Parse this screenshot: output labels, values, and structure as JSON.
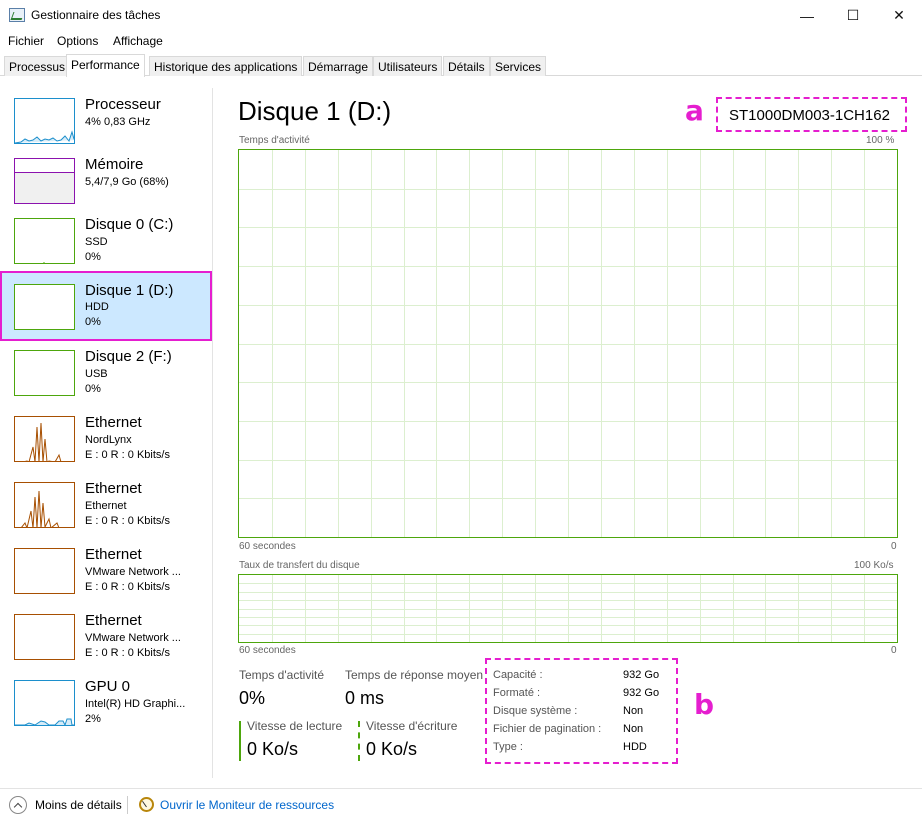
{
  "window": {
    "title": "Gestionnaire des tâches",
    "minimize_glyph": "—",
    "maximize_glyph": "☐",
    "close_glyph": "✕"
  },
  "menu": [
    "Fichier",
    "Options",
    "Affichage"
  ],
  "tabs": [
    "Processus",
    "Performance",
    "Historique des applications",
    "Démarrage",
    "Utilisateurs",
    "Détails",
    "Services"
  ],
  "active_tab": "Performance",
  "sidebar": {
    "items": [
      {
        "title": "Processeur",
        "sub1": "4% 0,83 GHz",
        "sub2": "",
        "color": "#1c8fcc"
      },
      {
        "title": "Mémoire",
        "sub1": "5,4/7,9 Go (68%)",
        "sub2": "",
        "color": "#8b12ae"
      },
      {
        "title": "Disque 0 (C:)",
        "sub1": "SSD",
        "sub2": "0%",
        "color": "#4da60c"
      },
      {
        "title": "Disque 1 (D:)",
        "sub1": "HDD",
        "sub2": "0%",
        "color": "#4da60c"
      },
      {
        "title": "Disque 2 (F:)",
        "sub1": "USB",
        "sub2": "0%",
        "color": "#4da60c"
      },
      {
        "title": "Ethernet",
        "sub1": "NordLynx",
        "sub2": "E : 0 R : 0 Kbits/s",
        "color": "#a74f01"
      },
      {
        "title": "Ethernet",
        "sub1": "Ethernet",
        "sub2": "E : 0 R : 0 Kbits/s",
        "color": "#a74f01"
      },
      {
        "title": "Ethernet",
        "sub1": "VMware Network ...",
        "sub2": "E : 0 R : 0 Kbits/s",
        "color": "#a74f01"
      },
      {
        "title": "Ethernet",
        "sub1": "VMware Network ...",
        "sub2": "E : 0 R : 0 Kbits/s",
        "color": "#a74f01"
      },
      {
        "title": "GPU 0",
        "sub1": "Intel(R) HD Graphi...",
        "sub2": "2%",
        "color": "#1c8fcc"
      }
    ],
    "selected_index": 3
  },
  "main": {
    "title": "Disque 1 (D:)",
    "model": "ST1000DM003-1CH162",
    "callout_a": "a",
    "callout_b": "b",
    "activity_graph": {
      "label": "Temps d'activité",
      "max_label": "100 %",
      "time_label": "60 secondes",
      "min_label": "0"
    },
    "transfer_graph": {
      "label": "Taux de transfert du disque",
      "max_label": "100 Ko/s",
      "time_label": "60 secondes",
      "min_label": "0"
    },
    "stats": {
      "activity_label": "Temps d'activité",
      "activity_value": "0%",
      "response_label": "Temps de réponse moyen",
      "response_value": "0 ms",
      "read_label": "Vitesse de lecture",
      "read_value": "0 Ko/s",
      "write_label": "Vitesse d'écriture",
      "write_value": "0 Ko/s"
    },
    "properties": [
      {
        "label": "Capacité :",
        "value": "932 Go"
      },
      {
        "label": "Formaté :",
        "value": "932 Go"
      },
      {
        "label": "Disque système :",
        "value": "Non"
      },
      {
        "label": "Fichier de pagination :",
        "value": "Non"
      },
      {
        "label": "Type :",
        "value": "HDD"
      }
    ]
  },
  "footer": {
    "less_details": "Moins de détails",
    "resource_monitor": "Ouvrir le Moniteur de ressources"
  },
  "colors": {
    "accent_callout": "#e51ecf",
    "disk_green": "#4da60c",
    "selected_bg": "#cce8ff",
    "link_blue": "#0066cc"
  }
}
